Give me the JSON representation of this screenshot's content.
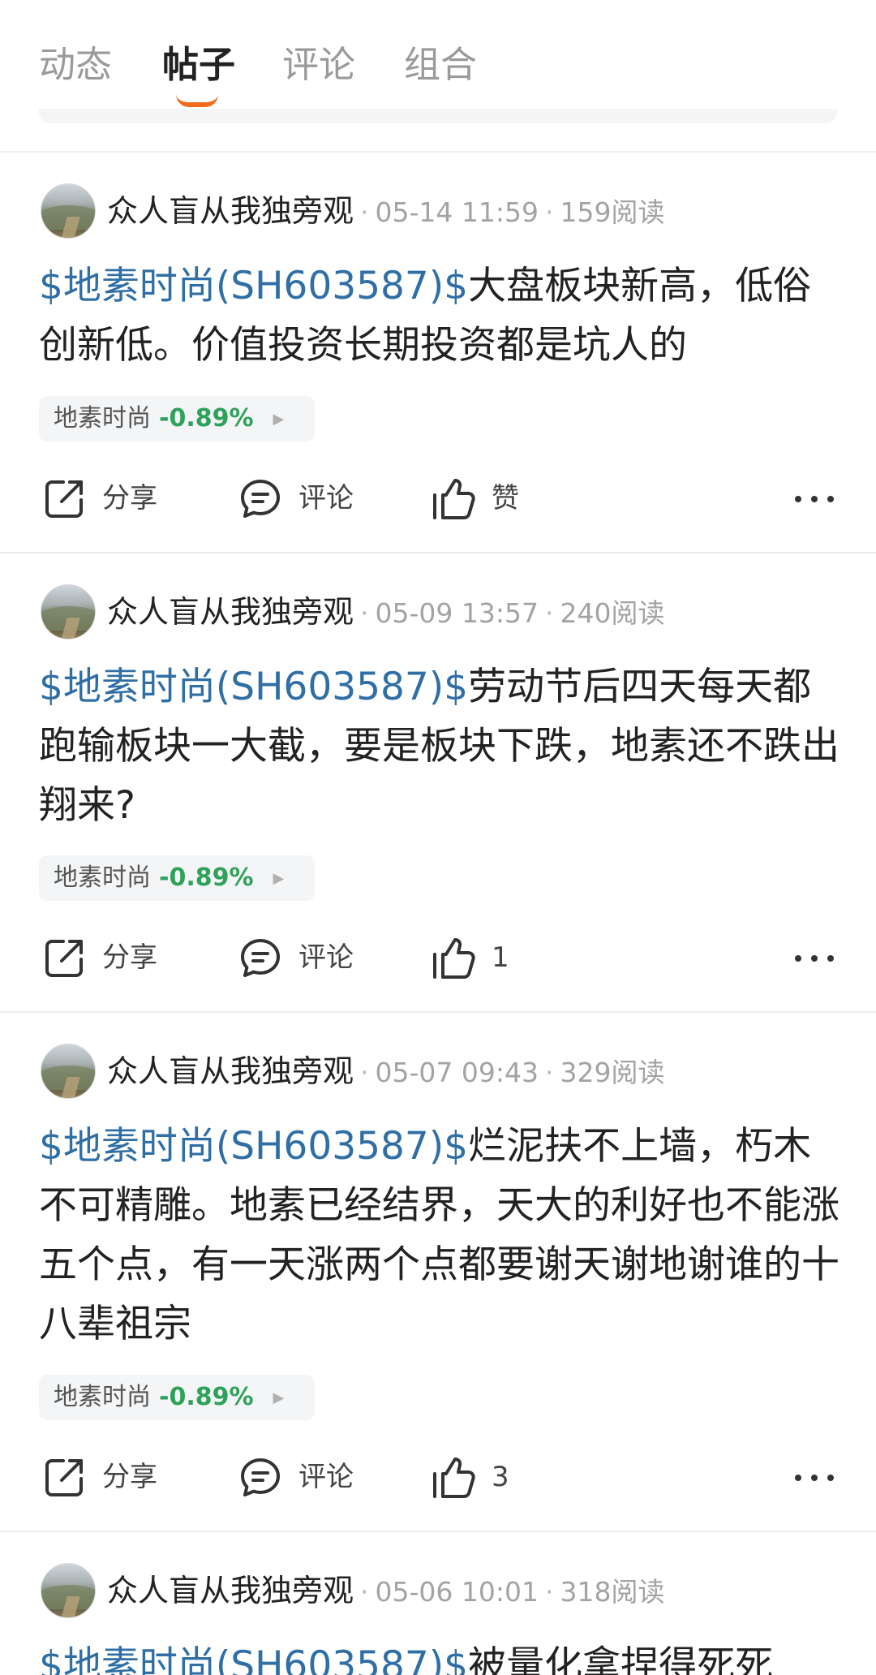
{
  "tabs": [
    {
      "label": "动态"
    },
    {
      "label": "帖子"
    },
    {
      "label": "评论"
    },
    {
      "label": "组合"
    }
  ],
  "active_tab_index": 1,
  "colors": {
    "accent": "#f26a1b",
    "stock_link": "#2f6fa5",
    "change_negative": "#2fa25a"
  },
  "actions": {
    "share_label": "分享",
    "comment_label": "评论"
  },
  "icons": [
    "share-icon",
    "comment-icon",
    "like-icon",
    "more-icon",
    "chip-arrow-icon"
  ],
  "posts": [
    {
      "author": "众人盲从我独旁观",
      "time": "05-14 11:59",
      "reads": "159阅读",
      "stock_link": "$地素时尚(SH603587)$",
      "text": "大盘板块新高，低俗创新低。价值投资长期投资都是坑人的",
      "chip_name": "地素时尚",
      "chip_change": "-0.89%",
      "likes": "赞"
    },
    {
      "author": "众人盲从我独旁观",
      "time": "05-09 13:57",
      "reads": "240阅读",
      "stock_link": "$地素时尚(SH603587)$",
      "text": "劳动节后四天每天都跑输板块一大截，要是板块下跌，地素还不跌出翔来?",
      "chip_name": "地素时尚",
      "chip_change": "-0.89%",
      "likes": "1"
    },
    {
      "author": "众人盲从我独旁观",
      "time": "05-07 09:43",
      "reads": "329阅读",
      "stock_link": "$地素时尚(SH603587)$",
      "text": "烂泥扶不上墙，朽木不可精雕。地素已经结界，天大的利好也不能涨五个点，有一天涨两个点都要谢天谢地谢谁的十八辈祖宗",
      "chip_name": "地素时尚",
      "chip_change": "-0.89%",
      "likes": "3"
    },
    {
      "author": "众人盲从我独旁观",
      "time": "05-06 10:01",
      "reads": "318阅读",
      "stock_link": "$地素时尚(SH603587)$",
      "text": "被量化拿捏得死死"
    }
  ]
}
